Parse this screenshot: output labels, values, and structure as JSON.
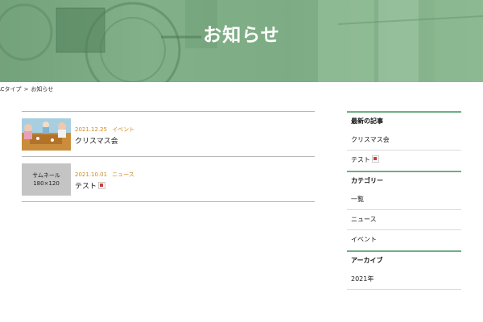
{
  "hero": {
    "title": "お知らせ"
  },
  "breadcrumb": {
    "parent": "ACタイプ",
    "separator": ">",
    "current": "お知らせ"
  },
  "news": {
    "items": [
      {
        "date": "2021.12.25",
        "category": "イベント",
        "title": "クリスマス会",
        "thumbnail": "photo",
        "new_badge": false
      },
      {
        "date": "2021.10.01",
        "category": "ニュース",
        "title": "テスト",
        "thumbnail_label_1": "サムネール",
        "thumbnail_label_2": "180×120",
        "new_badge": true
      }
    ]
  },
  "sidebar": {
    "recent_heading": "最新の記事",
    "recent": [
      {
        "label": "クリスマス会",
        "new_badge": false
      },
      {
        "label": "テスト",
        "new_badge": true
      }
    ],
    "category_heading": "カテゴリー",
    "categories": [
      "一覧",
      "ニュース",
      "イベント"
    ],
    "archive_heading": "アーカイブ",
    "archives": [
      "2021年"
    ]
  },
  "colors": {
    "accent_green": "#6fae84",
    "date_orange": "#d08a1e",
    "hero_green": "#7fae86"
  }
}
